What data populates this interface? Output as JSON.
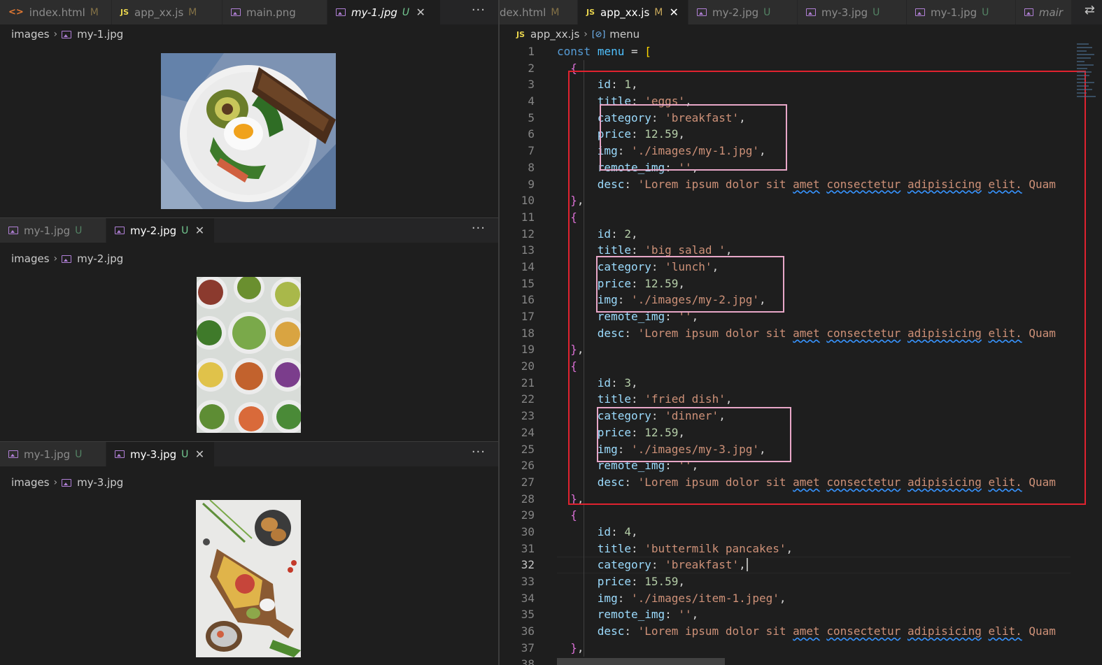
{
  "left_pane": {
    "top_tabs": [
      {
        "icon": "html-icon",
        "label": "index.html",
        "status": "M"
      },
      {
        "icon": "js-icon",
        "label": "app_xx.js",
        "status": "M"
      },
      {
        "icon": "image-icon",
        "label": "main.png",
        "status": ""
      },
      {
        "icon": "image-icon",
        "label": "my-1.jpg",
        "status": "U",
        "active": true
      }
    ],
    "groups": [
      {
        "breadcrumb": {
          "folder": "images",
          "file": "my-1.jpg"
        }
      },
      {
        "tabs": [
          {
            "label": "my-1.jpg",
            "status": "U"
          },
          {
            "label": "my-2.jpg",
            "status": "U",
            "active": true
          }
        ],
        "breadcrumb": {
          "folder": "images",
          "file": "my-2.jpg"
        }
      },
      {
        "tabs": [
          {
            "label": "my-1.jpg",
            "status": "U"
          },
          {
            "label": "my-3.jpg",
            "status": "U",
            "active": true
          }
        ],
        "breadcrumb": {
          "folder": "images",
          "file": "my-3.jpg"
        }
      }
    ],
    "more_label": "···",
    "close_glyph": "✕"
  },
  "right_pane": {
    "tabs": [
      {
        "label": "dex.html",
        "status": "M"
      },
      {
        "label": "app_xx.js",
        "status": "M",
        "active": true
      },
      {
        "label": "my-2.jpg",
        "status": "U"
      },
      {
        "label": "my-3.jpg",
        "status": "U"
      },
      {
        "label": "my-1.jpg",
        "status": "U"
      },
      {
        "label": "mair",
        "status": ""
      }
    ],
    "breadcrumb": {
      "file": "app_xx.js",
      "symbol": "menu"
    },
    "current_line": 32,
    "menu_items": [
      {
        "id": "1",
        "title": "'eggs'",
        "category": "'breakfast'",
        "price": "12.59",
        "img": "'./images/my-1.jpg'"
      },
      {
        "id": "2",
        "title": "'big salad '",
        "category": "'lunch'",
        "price": "12.59",
        "img": "'./images/my-2.jpg'"
      },
      {
        "id": "3",
        "title": "'fried dish'",
        "category": "'dinner'",
        "price": "12.59",
        "img": "'./images/my-3.jpg'"
      },
      {
        "id": "4",
        "title": "'buttermilk pancakes'",
        "category": "'breakfast'",
        "price": "15.59",
        "img": "'./images/item-1.jpeg'"
      }
    ],
    "remote_img": "''",
    "desc_prefix": "'Lorem ipsum dolor sit ",
    "desc_words": [
      "amet",
      "consectetur",
      "adipisicing",
      "elit."
    ],
    "desc_suffix": "Quam",
    "decl": {
      "keyword": "const",
      "name": "menu"
    },
    "first_line_number": 1,
    "last_line_number": 38
  }
}
